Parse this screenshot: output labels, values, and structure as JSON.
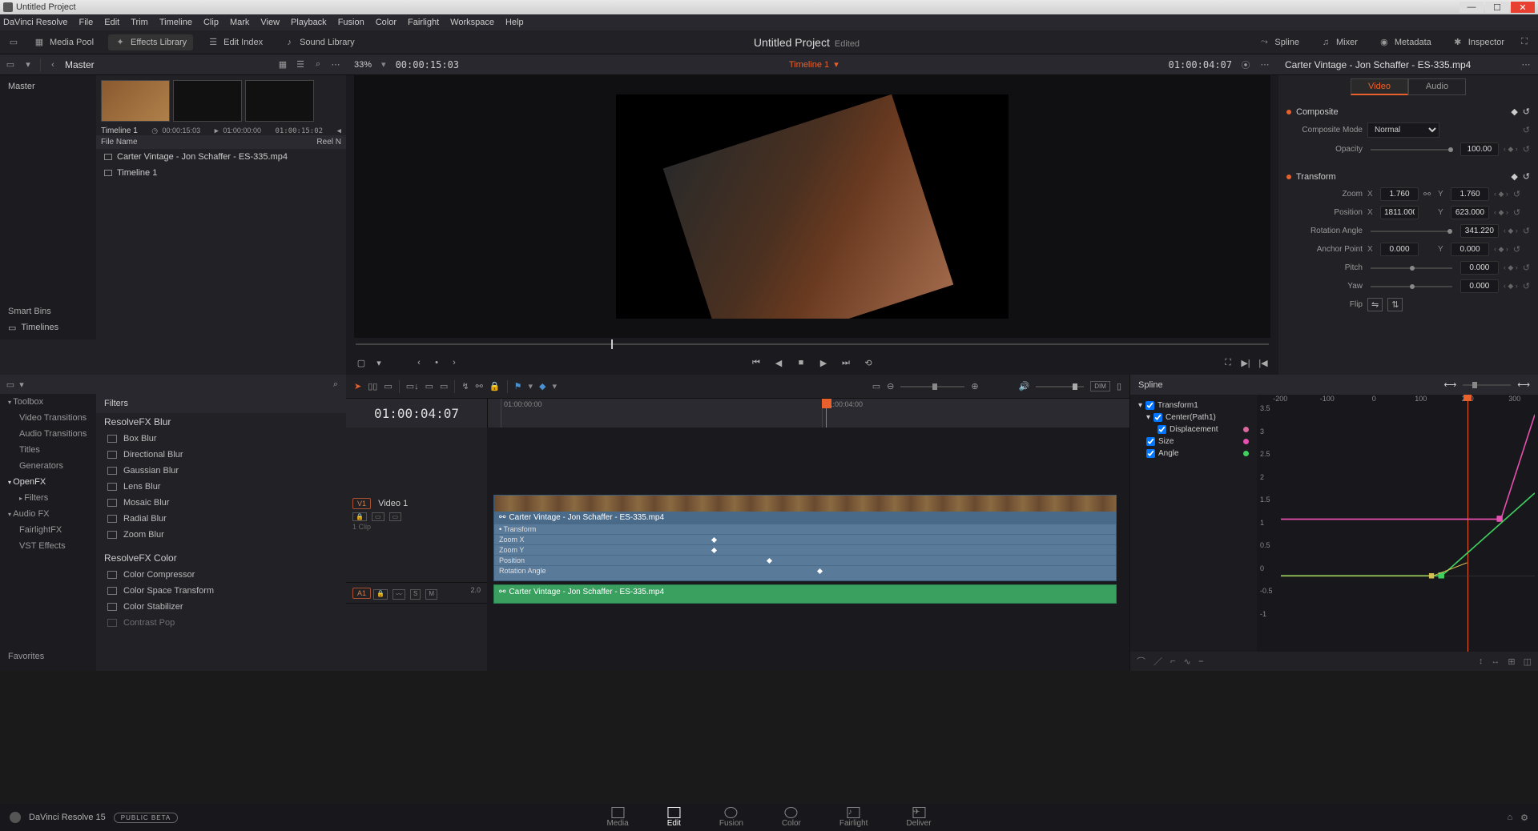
{
  "window": {
    "title": "Untitled Project"
  },
  "menubar": [
    "DaVinci Resolve",
    "File",
    "Edit",
    "Trim",
    "Timeline",
    "Clip",
    "Mark",
    "View",
    "Playback",
    "Fusion",
    "Color",
    "Fairlight",
    "Workspace",
    "Help"
  ],
  "toolbar": {
    "media_pool": "Media Pool",
    "effects_library": "Effects Library",
    "edit_index": "Edit Index",
    "sound_library": "Sound Library",
    "project_title": "Untitled Project",
    "edited": "Edited",
    "spline": " Spline",
    "mixer": "Mixer",
    "metadata": "Metadata",
    "inspector": "Inspector"
  },
  "subheader": {
    "master": "Master",
    "zoom": "33%",
    "tc": "00:00:15:03",
    "timeline_name": "Timeline 1",
    "viewer_tc": "01:00:04:07"
  },
  "mediapool": {
    "tree": {
      "master": "Master",
      "smart_bins": "Smart Bins",
      "timelines": "Timelines"
    },
    "thumb_label": "Timeline 1",
    "thumb_tc1": "00:00:15:03",
    "thumb_tc2": "01:00:00:00",
    "thumb_tc3": "01:00:15:02",
    "file_header": {
      "name": "File Name",
      "reel": "Reel N"
    },
    "files": [
      "Carter Vintage - Jon Schaffer - ES-335.mp4",
      "Timeline 1"
    ]
  },
  "inspector": {
    "clip_name": "Carter Vintage - Jon Schaffer - ES-335.mp4",
    "tabs": {
      "video": "Video",
      "audio": "Audio"
    },
    "composite": {
      "title": "Composite",
      "mode_label": "Composite Mode",
      "mode_value": "Normal",
      "opacity_label": "Opacity",
      "opacity_value": "100.00"
    },
    "transform": {
      "title": "Transform",
      "zoom_label": "Zoom",
      "zoom_x": "1.760",
      "zoom_y": "1.760",
      "position_label": "Position",
      "pos_x": "1811.000",
      "pos_y": "623.000",
      "rotation_label": "Rotation Angle",
      "rotation_value": "341.220",
      "anchor_label": "Anchor Point",
      "anchor_x": "0.000",
      "anchor_y": "0.000",
      "pitch_label": "Pitch",
      "pitch_value": "0.000",
      "yaw_label": "Yaw",
      "yaw_value": "0.000",
      "flip_label": "Flip"
    }
  },
  "effects": {
    "tree": {
      "toolbox": "Toolbox",
      "video_transitions": "Video Transitions",
      "audio_transitions": "Audio Transitions",
      "titles": "Titles",
      "generators": "Generators",
      "openfx": "OpenFX",
      "filters": "Filters",
      "audiofx": "Audio FX",
      "fairlightfx": "FairlightFX",
      "vst": "VST Effects",
      "favorites": "Favorites"
    },
    "list_header": "Filters",
    "group1": "ResolveFX Blur",
    "items1": [
      "Box Blur",
      "Directional Blur",
      "Gaussian Blur",
      "Lens Blur",
      "Mosaic Blur",
      "Radial Blur",
      "Zoom Blur"
    ],
    "group2": "ResolveFX Color",
    "items2": [
      "Color Compressor",
      "Color Space Transform",
      "Color Stabilizer",
      "Contrast Pop"
    ]
  },
  "timeline": {
    "tc": "01:00:04:07",
    "ruler": [
      "01:00:00:00",
      "01:00:04:00"
    ],
    "v1": {
      "tag": "V1",
      "name": "Video 1",
      "clips": "1 Clip"
    },
    "a1": {
      "tag": "A1",
      "sr": "2.0"
    },
    "clip": {
      "name": "Carter Vintage - Jon Schaffer - ES-335.mp4",
      "transform": "Transform",
      "zoom_x": "Zoom X",
      "zoom_y": "Zoom Y",
      "position": "Position",
      "rotation": "Rotation Angle"
    }
  },
  "spline": {
    "title": "Spline",
    "tree": {
      "transform1": "Transform1",
      "center": "Center(Path1)",
      "displacement": "Displacement",
      "size": "Size",
      "angle": "Angle"
    },
    "axis_x": [
      "-200",
      "-100",
      "0",
      "100",
      "200",
      "300"
    ],
    "axis_y": [
      "3.5",
      "3",
      "2.5",
      "2",
      "1.5",
      "1",
      "0.5",
      "0",
      "-0.5",
      "-1"
    ]
  },
  "bottombar": {
    "app": "DaVinci Resolve 15",
    "badge": "PUBLIC BETA",
    "pages": [
      "Media",
      "Edit",
      "Fusion",
      "Color",
      "Fairlight",
      "Deliver"
    ]
  }
}
